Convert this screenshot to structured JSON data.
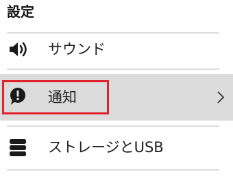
{
  "header": {
    "title": "設定"
  },
  "settings_list": {
    "items": [
      {
        "label": "サウンド",
        "icon": "speaker-icon"
      },
      {
        "label": "通知",
        "icon": "alert-circle-icon",
        "selected": true,
        "has_chevron": true
      },
      {
        "label": "ストレージとUSB",
        "icon": "storage-icon"
      }
    ]
  },
  "colors": {
    "highlight_border": "#e0202a",
    "selected_row_background": "#dcdcdc",
    "divider": "#dcdcdc"
  }
}
